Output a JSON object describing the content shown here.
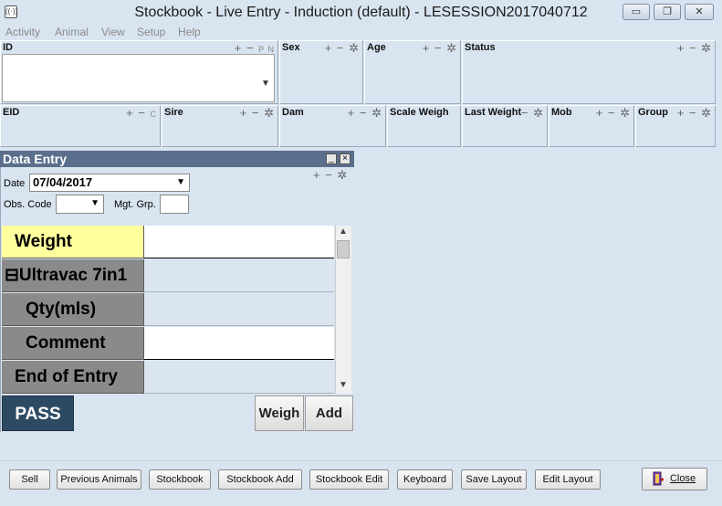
{
  "window": {
    "title": "Stockbook - Live Entry - Induction (default) - LESESSION2017040712",
    "icon": "radio-waves-icon",
    "minimize": "▭",
    "restore": "❐",
    "close": "✕"
  },
  "menu": [
    "Activity",
    "Animal",
    "View",
    "Setup",
    "Help"
  ],
  "panels_top": [
    {
      "label": "ID",
      "tools": "+ − ",
      "extra": "P N"
    },
    {
      "label": "Sex",
      "tools": "+ − ✲"
    },
    {
      "label": "Age",
      "tools": "+ − ✲"
    },
    {
      "label": "Status",
      "tools": "+ − ✲"
    }
  ],
  "panels_second": [
    {
      "label": "EID",
      "tools": "+ − ",
      "extra": "C"
    },
    {
      "label": "Sire",
      "tools": "+ − ✲"
    },
    {
      "label": "Dam",
      "tools": "+ − ✲"
    },
    {
      "label": "Scale Weigh",
      "tools": "− ✲"
    },
    {
      "label": "Last Weight",
      "tools": "− ✲"
    },
    {
      "label": "Mob",
      "tools": "+ − ✲"
    },
    {
      "label": "Group",
      "tools": "+ − ✲"
    }
  ],
  "data_entry": {
    "title": "Data Entry",
    "minimize": "_",
    "close": "×",
    "date_label": "Date",
    "date_value": "07/04/2017",
    "obs_label": "Obs. Code",
    "mgt_label": "Mgt. Grp.",
    "tools": "+ − ✲",
    "rows": [
      {
        "label": "Weight"
      },
      {
        "label": "⊟Ultravac 7in1"
      },
      {
        "label": "Qty(mls)"
      },
      {
        "label": "Comment"
      },
      {
        "label": "End of Entry"
      }
    ],
    "pass": "PASS",
    "weigh": "Weigh",
    "add": "Add"
  },
  "bottom_buttons": [
    "Sell",
    "Previous Animals",
    "Stockbook",
    "Stockbook Add",
    "Stockbook Edit",
    "Keyboard",
    "Save Layout",
    "Edit Layout"
  ],
  "close_label": "Close",
  "colors": {
    "background": "#d9e4f1",
    "header": "#5a6f8c",
    "pass": "#2d4a63",
    "highlight": "#ffff9e"
  }
}
